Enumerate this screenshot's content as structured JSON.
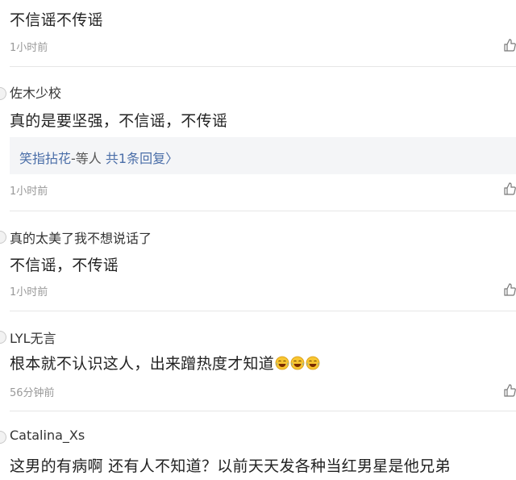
{
  "comments": [
    {
      "username": "",
      "content": "不信谣不传谣",
      "time": "1小时前"
    },
    {
      "username": "佐木少校",
      "content": "真的是要坚强，不信谣，不传谣",
      "time": "1小时前",
      "reply": {
        "names": "笑指拈花",
        "suffix": "-等人",
        "count": "共1条回复",
        "chevron": "〉"
      }
    },
    {
      "username": "真的太美了我不想说话了",
      "content": "不信谣，不传谣",
      "time": "1小时前"
    },
    {
      "username": "LYL无言",
      "content": "根本就不认识这人，出来蹭热度才知道",
      "time": "56分钟前",
      "emoji_count": 3
    },
    {
      "username": "Catalina_Xs",
      "content": "这男的有病啊 还有人不知道？以前天天发各种当红男星是他兄弟",
      "time": ""
    }
  ],
  "icons": {
    "like": "thumbs-up-icon",
    "emoji": "laughing-tears-emoji-icon"
  },
  "colors": {
    "link": "#4a6ea8",
    "time": "#999999",
    "divider": "#e6e6e6",
    "reply_bg": "#f4f5f7"
  }
}
